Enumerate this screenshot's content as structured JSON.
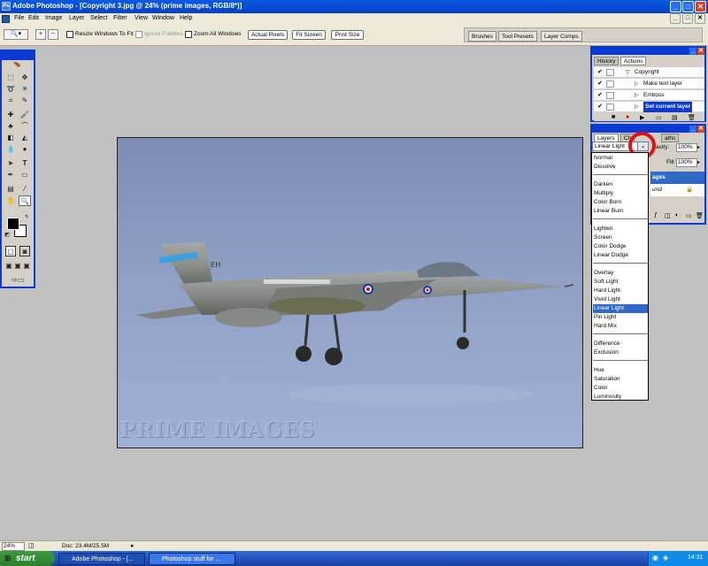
{
  "window": {
    "title": "Adobe Photoshop - [Copyright 3.jpg @ 24% (prime images, RGB/8*)]",
    "min": "_",
    "max": "□",
    "close": "✕"
  },
  "menu": [
    "File",
    "Edit",
    "Image",
    "Layer",
    "Select",
    "Filter",
    "View",
    "Window",
    "Help"
  ],
  "options": {
    "resize": "Resize Windows To Fit",
    "ignore": "Ignore Palettes",
    "zoom_all": "Zoom All Windows",
    "actual_pixels": "Actual Pixels",
    "fit_screen": "Fit Screen",
    "print_size": "Print Size"
  },
  "palette_well": [
    "Brushes",
    "Tool Presets",
    "Layer Comps"
  ],
  "actions": {
    "tabs": [
      "History",
      "Actions"
    ],
    "items": [
      {
        "label": "Copyright",
        "check": "✔",
        "arrow": "▽"
      },
      {
        "label": "Make text layer",
        "check": "✔",
        "arrow": "▷"
      },
      {
        "label": "Emboss",
        "check": "✔",
        "arrow": "▷"
      },
      {
        "label": "Set current layer",
        "check": "✔",
        "arrow": "▷"
      }
    ]
  },
  "layers": {
    "tabs": [
      "Layers",
      "Ch",
      "aths"
    ],
    "blend_mode": "Linear Light",
    "opacity_label": "acity:",
    "opacity_value": "100%",
    "fill_label": "Fill:",
    "fill_value": "100%",
    "layer_name": "ages",
    "layer2_name": "und",
    "blend_options": [
      [
        "Normal",
        "Dissolve"
      ],
      [
        "Darken",
        "Multiply",
        "Color Burn",
        "Linear Burn"
      ],
      [
        "Lighten",
        "Screen",
        "Color Dodge",
        "Linear Dodge"
      ],
      [
        "Overlay",
        "Soft Light",
        "Hard Light",
        "Vivid Light",
        "Linear Light",
        "Pin Light",
        "Hard Mix"
      ],
      [
        "Difference",
        "Exclusion"
      ],
      [
        "Hue",
        "Saturation",
        "Color",
        "Luminosity"
      ]
    ]
  },
  "canvas": {
    "watermark": "PRIME IMAGES",
    "tail_code": "EH"
  },
  "status": {
    "zoom": "24%",
    "doc": "Doc: 23.4M/25.5M"
  },
  "taskbar": {
    "start": "start",
    "tasks": [
      "Adobe Photoshop - [...",
      "Photoshop stuff for ..."
    ],
    "clock": "14:31"
  },
  "colors": {
    "title_blue": "#0a3ad0",
    "accent_red": "#e0101a",
    "selection": "#316ac5"
  }
}
